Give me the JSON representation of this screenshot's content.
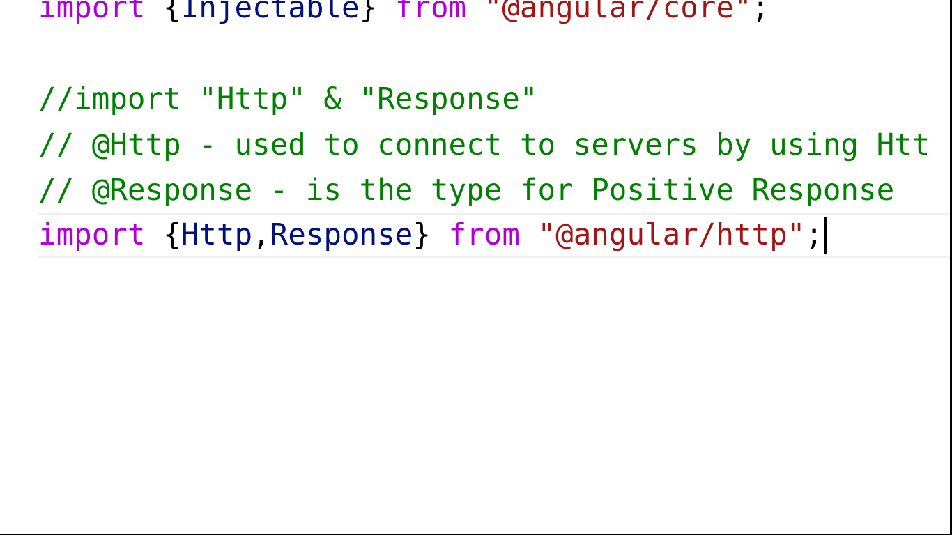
{
  "editor": {
    "lines": [
      {
        "tokens": [
          {
            "text": "import",
            "kind": "keyword"
          },
          {
            "text": " {",
            "kind": "punct"
          },
          {
            "text": "Injectable",
            "kind": "identifier"
          },
          {
            "text": "} ",
            "kind": "punct"
          },
          {
            "text": "from",
            "kind": "keyword"
          },
          {
            "text": " ",
            "kind": "punct"
          },
          {
            "text": "\"@angular/core\"",
            "kind": "string"
          },
          {
            "text": ";",
            "kind": "punct"
          }
        ]
      },
      {
        "comment": "//import \"Http\" & \"Response\""
      },
      {
        "comment": "// @Http - used to connect to servers by using Htt"
      },
      {
        "comment": "// @Response - is the type for Positive Response"
      },
      {
        "tokens": [
          {
            "text": "import",
            "kind": "keyword"
          },
          {
            "text": " {",
            "kind": "punct"
          },
          {
            "text": "Http",
            "kind": "identifier"
          },
          {
            "text": ",",
            "kind": "punct"
          },
          {
            "text": "Response",
            "kind": "identifier"
          },
          {
            "text": "} ",
            "kind": "punct"
          },
          {
            "text": "from",
            "kind": "keyword"
          },
          {
            "text": " ",
            "kind": "punct"
          },
          {
            "text": "\"@angular/http\"",
            "kind": "string"
          },
          {
            "text": ";",
            "kind": "punct"
          }
        ]
      }
    ],
    "colors": {
      "keyword": "#af00db",
      "identifier": "#001080",
      "string": "#a31515",
      "comment": "#008000",
      "punct": "#000000"
    }
  }
}
